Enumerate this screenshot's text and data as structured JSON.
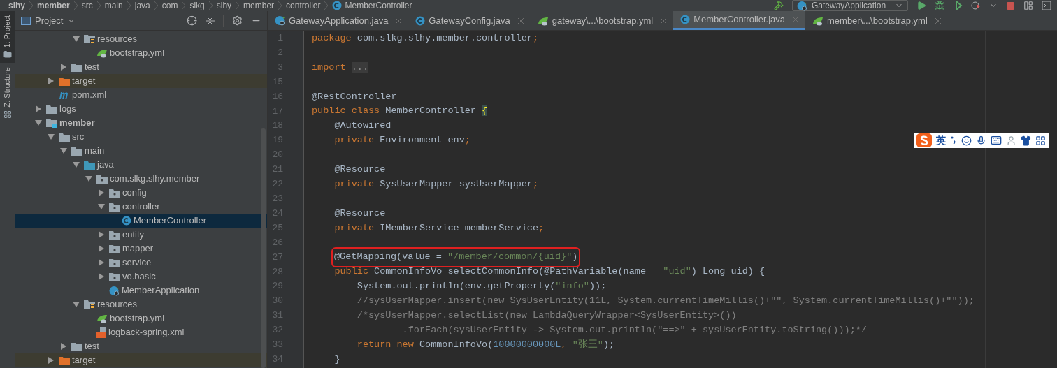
{
  "breadcrumb": [
    {
      "label": "slhy",
      "bold": true
    },
    {
      "label": "member",
      "bold": true
    },
    {
      "label": "src",
      "bold": false
    },
    {
      "label": "main",
      "bold": false
    },
    {
      "label": "java",
      "bold": false
    },
    {
      "label": "com",
      "bold": false
    },
    {
      "label": "slkg",
      "bold": false
    },
    {
      "label": "slhy",
      "bold": false
    },
    {
      "label": "member",
      "bold": false
    },
    {
      "label": "controller",
      "bold": false
    },
    {
      "label": "MemberController",
      "bold": false,
      "kind": "class"
    }
  ],
  "toolbar": {
    "run_configuration": "GatewayApplication"
  },
  "side_tabs": [
    {
      "label": "1: Project",
      "selected": true,
      "kind": "project"
    },
    {
      "label": "Z: Structure",
      "selected": false,
      "kind": "structure"
    }
  ],
  "project_panel": {
    "title": "Project",
    "tree": [
      {
        "children": [
          {
            "children": [
              {
                "children": [
                  {
                    "label": "resources",
                    "kind": "resources",
                    "expanded": true,
                    "selected": false,
                    "children": [
                      {
                        "label": "bootstrap.yml",
                        "kind": "yml",
                        "selected": false
                      }
                    ]
                  }
                ]
              },
              {
                "label": "test",
                "kind": "folder",
                "expanded": false,
                "selected": false
              }
            ]
          },
          {
            "label": "target",
            "kind": "excluded",
            "expanded": false,
            "selected": false
          },
          {
            "label": "pom.xml",
            "kind": "maven",
            "selected": false
          }
        ]
      },
      {
        "label": "logs",
        "kind": "folder",
        "expanded": false,
        "selected": false
      },
      {
        "label": "member",
        "kind": "module",
        "expanded": true,
        "selected": false,
        "children": [
          {
            "label": "src",
            "kind": "folder",
            "expanded": true,
            "selected": false,
            "children": [
              {
                "label": "main",
                "kind": "folder",
                "expanded": true,
                "selected": false,
                "children": [
                  {
                    "label": "java",
                    "kind": "source",
                    "expanded": true,
                    "selected": false,
                    "children": [
                      {
                        "label": "com.slkg.slhy.member",
                        "kind": "package",
                        "expanded": true,
                        "selected": false,
                        "children": [
                          {
                            "label": "config",
                            "kind": "package",
                            "expanded": false,
                            "selected": false
                          },
                          {
                            "label": "controller",
                            "kind": "package",
                            "expanded": true,
                            "selected": false,
                            "children": [
                              {
                                "label": "MemberController",
                                "kind": "class",
                                "selected": true
                              }
                            ]
                          },
                          {
                            "label": "entity",
                            "kind": "package",
                            "expanded": false,
                            "selected": false
                          },
                          {
                            "label": "mapper",
                            "kind": "package",
                            "expanded": false,
                            "selected": false
                          },
                          {
                            "label": "service",
                            "kind": "package",
                            "expanded": false,
                            "selected": false
                          },
                          {
                            "label": "vo.basic",
                            "kind": "package",
                            "expanded": false,
                            "selected": false
                          },
                          {
                            "label": "MemberApplication",
                            "kind": "spring",
                            "selected": false
                          }
                        ]
                      }
                    ]
                  },
                  {
                    "label": "resources",
                    "kind": "resources",
                    "expanded": true,
                    "selected": false,
                    "children": [
                      {
                        "label": "bootstrap.yml",
                        "kind": "yml",
                        "selected": false
                      },
                      {
                        "label": "logback-spring.xml",
                        "kind": "xml",
                        "selected": false
                      }
                    ]
                  }
                ]
              },
              {
                "label": "test",
                "kind": "folder",
                "expanded": false,
                "selected": false
              }
            ]
          },
          {
            "label": "target",
            "kind": "excluded",
            "expanded": false,
            "selected": false
          }
        ]
      }
    ]
  },
  "editor_tabs": [
    {
      "label": "GatewayApplication.java",
      "kind": "spring",
      "selected": false
    },
    {
      "label": "GatewayConfig.java",
      "kind": "class",
      "selected": false
    },
    {
      "label": "gateway\\...\\bootstrap.yml",
      "kind": "yml",
      "selected": false
    },
    {
      "label": "MemberController.java",
      "kind": "class",
      "selected": true
    },
    {
      "label": "member\\...\\bootstrap.yml",
      "kind": "yml",
      "selected": false
    }
  ],
  "code": [
    {
      "number": "1",
      "tokens": [
        {
          "kind": "keyword",
          "text": "package"
        },
        {
          "kind": "plain",
          "text": " com.slkg.slhy.member.controller"
        },
        {
          "kind": "keyword",
          "text": ";"
        }
      ]
    },
    {
      "number": "2"
    },
    {
      "number": "3",
      "tokens": [
        {
          "kind": "keyword",
          "text": "import "
        },
        {
          "kind": "folded",
          "text": "..."
        }
      ]
    },
    {
      "number": "15"
    },
    {
      "number": "16",
      "tokens": [
        {
          "kind": "plain",
          "text": "@RestController"
        }
      ]
    },
    {
      "number": "17",
      "tokens": [
        {
          "kind": "keyword",
          "text": "public class"
        },
        {
          "kind": "plain",
          "text": " MemberController "
        },
        {
          "kind": "brace",
          "text": "{"
        }
      ]
    },
    {
      "number": "18",
      "tokens": [
        {
          "kind": "plain",
          "text": "    @Autowired"
        }
      ]
    },
    {
      "number": "19",
      "tokens": [
        {
          "kind": "keyword",
          "text": "    private"
        },
        {
          "kind": "plain",
          "text": " Environment env"
        },
        {
          "kind": "keyword",
          "text": ";"
        }
      ]
    },
    {
      "number": "20"
    },
    {
      "number": "21",
      "tokens": [
        {
          "kind": "plain",
          "text": "    @Resource"
        }
      ]
    },
    {
      "number": "22",
      "tokens": [
        {
          "kind": "keyword",
          "text": "    private"
        },
        {
          "kind": "plain",
          "text": " SysUserMapper sysUserMapper"
        },
        {
          "kind": "keyword",
          "text": ";"
        }
      ]
    },
    {
      "number": "23"
    },
    {
      "number": "24",
      "tokens": [
        {
          "kind": "plain",
          "text": "    @Resource"
        }
      ]
    },
    {
      "number": "25",
      "tokens": [
        {
          "kind": "keyword",
          "text": "    private"
        },
        {
          "kind": "plain",
          "text": " IMemberService memberService"
        },
        {
          "kind": "keyword",
          "text": ";"
        }
      ]
    },
    {
      "number": "26"
    },
    {
      "number": "27",
      "boxed": true,
      "tokens": [
        {
          "kind": "plain",
          "text": "@GetMapping(value = "
        },
        {
          "kind": "string",
          "text": "\"/member/common/{uid}\""
        },
        {
          "kind": "plain",
          "text": ")"
        }
      ]
    },
    {
      "number": "28",
      "tokens": [
        {
          "kind": "keyword",
          "text": "    public"
        },
        {
          "kind": "plain",
          "text": " CommonInfoVo selectCommonInfo(@PathVariable(name = "
        },
        {
          "kind": "string",
          "text": "\"uid\""
        },
        {
          "kind": "plain",
          "text": ") Long uid) {"
        }
      ]
    },
    {
      "number": "29",
      "tokens": [
        {
          "kind": "plain",
          "text": "        System.out.println(env.getProperty("
        },
        {
          "kind": "string",
          "text": "\"info\""
        },
        {
          "kind": "plain",
          "text": "));"
        }
      ]
    },
    {
      "number": "30",
      "tokens": [
        {
          "kind": "comment",
          "text": "        //sysUserMapper.insert(new SysUserEntity(11L, System.currentTimeMillis()+\"\", System.currentTimeMillis()+\"\"));"
        }
      ]
    },
    {
      "number": "31",
      "tokens": [
        {
          "kind": "comment",
          "text": "        /*sysUserMapper.selectList(new LambdaQueryWrapper<SysUserEntity>())"
        }
      ]
    },
    {
      "number": "32",
      "tokens": [
        {
          "kind": "comment",
          "text": "                .forEach(sysUserEntity -> System.out.println(\"==>\" + sysUserEntity.toString()));*/"
        }
      ]
    },
    {
      "number": "33",
      "tokens": [
        {
          "kind": "keyword",
          "text": "        return new"
        },
        {
          "kind": "plain",
          "text": " CommonInfoVo("
        },
        {
          "kind": "number",
          "text": "10000000000L"
        },
        {
          "kind": "keyword",
          "text": ", "
        },
        {
          "kind": "string",
          "text": "\"张三\""
        },
        {
          "kind": "plain",
          "text": ");"
        }
      ]
    },
    {
      "number": "34",
      "tokens": [
        {
          "kind": "plain",
          "text": "    }"
        }
      ]
    }
  ],
  "ime_toolbar": {
    "language": "英"
  }
}
